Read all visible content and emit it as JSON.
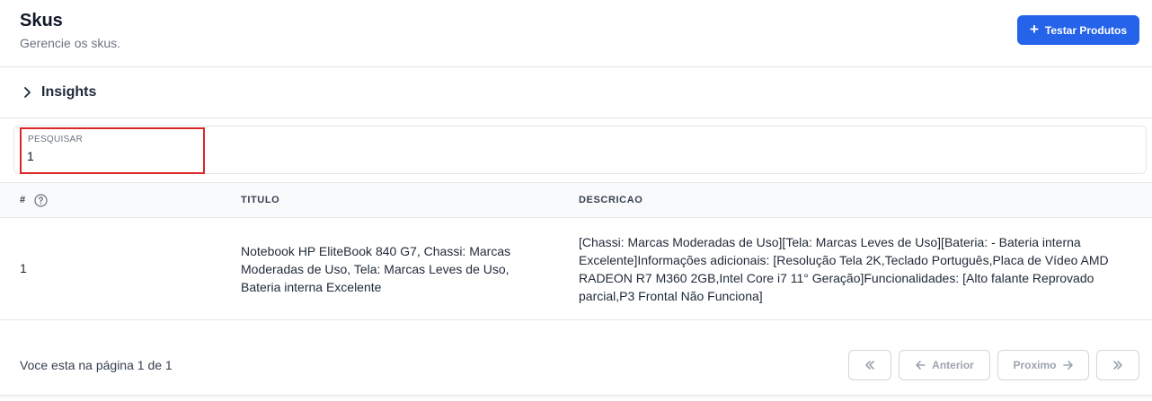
{
  "header": {
    "title": "Skus",
    "subtitle": "Gerencie os skus.",
    "action_label": "Testar Produtos",
    "action_icon": "plus-icon",
    "accent": "#2563eb"
  },
  "insights": {
    "label": "Insights",
    "icon": "chevron-right-icon"
  },
  "search": {
    "label": "PESQUISAR",
    "value": "1",
    "highlight": "#dc2626"
  },
  "table": {
    "columns": [
      "#",
      "TITULO",
      "DESCRICAO"
    ],
    "rows": [
      {
        "id": "1",
        "title_lines": [
          "Notebook HP EliteBook 840 G7, Chassi: Marcas",
          "Moderadas de Uso, Tela: Marcas Leves de Uso,",
          "Bateria interna Excelente"
        ],
        "description_lines": [
          "[Chassi: Marcas Moderadas de Uso][Tela: Marcas Leves de Uso][Bateria: - Bateria interna",
          "Excelente]Informações adicionais: [Resolução Tela 2K,Teclado Português,Placa de Vídeo AMD",
          "RADEON R7 M360 2GB,Intel Core i7 11° Geração]Funcionalidades: [Alto falante Reprovado",
          "parcial,P3 Frontal Não Funciona]"
        ]
      }
    ]
  },
  "pagination": {
    "info": "Voce esta na página 1 de 1",
    "first_icon": "double-chevron-left-icon",
    "prev_label": "Anterior",
    "next_label": "Proximo",
    "last_icon": "double-chevron-right-icon"
  }
}
